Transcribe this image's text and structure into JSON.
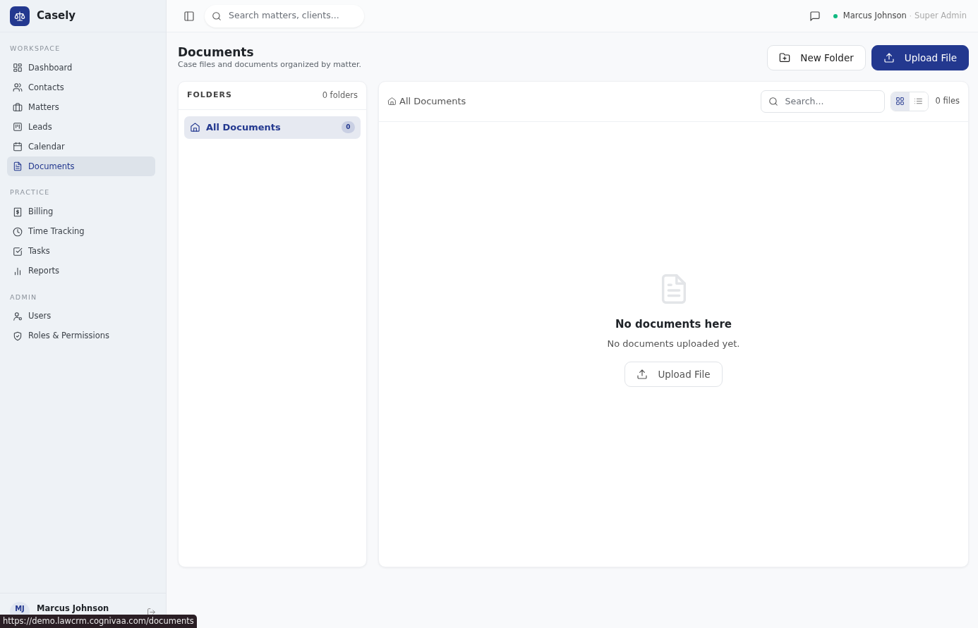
{
  "app": {
    "name": "Casely"
  },
  "sidebar": {
    "sections": [
      {
        "title": "WORKSPACE",
        "items": [
          {
            "label": "Dashboard",
            "selected": false
          },
          {
            "label": "Contacts",
            "selected": false
          },
          {
            "label": "Matters",
            "selected": false
          },
          {
            "label": "Leads",
            "selected": false
          },
          {
            "label": "Calendar",
            "selected": false
          },
          {
            "label": "Documents",
            "selected": true
          }
        ]
      },
      {
        "title": "PRACTICE",
        "items": [
          {
            "label": "Billing",
            "selected": false
          },
          {
            "label": "Time Tracking",
            "selected": false
          },
          {
            "label": "Tasks",
            "selected": false
          },
          {
            "label": "Reports",
            "selected": false
          }
        ]
      },
      {
        "title": "ADMIN",
        "items": [
          {
            "label": "Users",
            "selected": false
          },
          {
            "label": "Roles & Permissions",
            "selected": false
          }
        ]
      }
    ]
  },
  "user_footer": {
    "initials": "MJ",
    "name": "Marcus Johnson"
  },
  "status_url": "https://demo.lawcrm.cognivaa.com/documents",
  "topbar": {
    "search": {
      "placeholder": "Search matters, clients..."
    },
    "user": {
      "name": "Marcus Johnson",
      "separator": "·",
      "role": "Super Admin",
      "online": true
    }
  },
  "page": {
    "title": "Documents",
    "subtitle": "Case files and documents organized by matter.",
    "buttons": [
      {
        "label": "New Folder",
        "kind": "secondary"
      },
      {
        "label": "Upload File",
        "kind": "primary"
      }
    ]
  },
  "folders": {
    "title": "FOLDERS",
    "count": "0 folders",
    "items": [
      {
        "label": "All Documents",
        "count": "0",
        "selected": true
      }
    ]
  },
  "documents": {
    "breadcrumb": "All Documents",
    "search": {
      "placeholder": "Search..."
    },
    "views": [
      {
        "kind": "grid",
        "selected": true
      },
      {
        "kind": "list",
        "selected": false
      }
    ],
    "count": "0 files",
    "empty": {
      "title": "No documents here",
      "message": "No documents uploaded yet.",
      "button": "Upload File"
    }
  }
}
